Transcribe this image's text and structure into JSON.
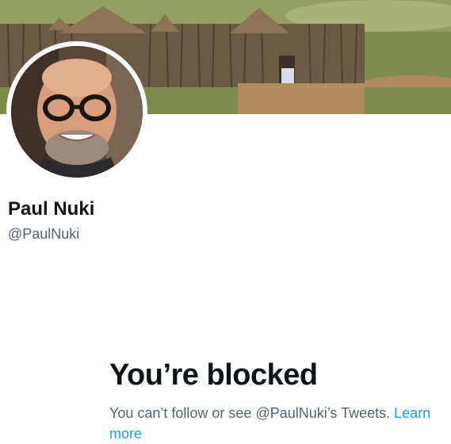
{
  "profile": {
    "display_name": "Paul Nuki",
    "handle": "@PaulNuki"
  },
  "blocked": {
    "title": "You’re blocked",
    "message": "You can’t follow or see @PaulNuki’s Tweets.",
    "link_text": "Learn more"
  },
  "colors": {
    "text_primary": "#0f1419",
    "text_secondary": "#536471",
    "link": "#1d9bf0"
  }
}
